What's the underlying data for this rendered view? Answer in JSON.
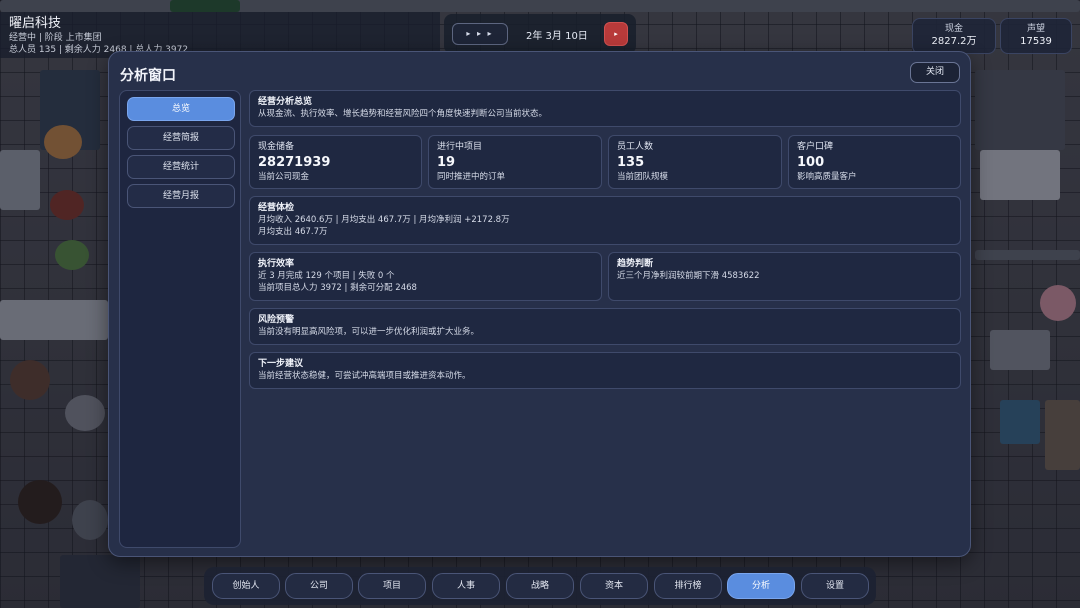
{
  "hud": {
    "company_name": "曜启科技",
    "status_line": "经营中 | 阶段 上市集团",
    "staff_line": "总人员 135 | 剩余人力 2468 | 总人力 3972",
    "speed_label": "▸ ▸ ▸",
    "date": "2年 3月 10日",
    "pause_label": "▸",
    "cash": {
      "label": "现金",
      "value": "2827.2万"
    },
    "reputation": {
      "label": "声望",
      "value": "17539"
    }
  },
  "window": {
    "title": "分析窗口",
    "close_label": "关闭",
    "nav": [
      {
        "label": "总览",
        "active": true
      },
      {
        "label": "经营简报",
        "active": false
      },
      {
        "label": "经营统计",
        "active": false
      },
      {
        "label": "经营月报",
        "active": false
      }
    ],
    "overview": {
      "title": "经营分析总览",
      "desc": "从现金流、执行效率、增长趋势和经营风险四个角度快速判断公司当前状态。"
    },
    "kpis": [
      {
        "label": "现金储备",
        "value": "28271939",
        "sub": "当前公司现金"
      },
      {
        "label": "进行中项目",
        "value": "19",
        "sub": "同时推进中的订单"
      },
      {
        "label": "员工人数",
        "value": "135",
        "sub": "当前团队规模"
      },
      {
        "label": "客户口碑",
        "value": "100",
        "sub": "影响高质量客户"
      }
    ],
    "health": {
      "title": "经营体检",
      "line1": "月均收入 2640.6万 | 月均支出 467.7万 | 月均净利润 +2172.8万",
      "line2": "月均支出 467.7万"
    },
    "efficiency": {
      "title": "执行效率",
      "line1": "近 3 月完成 129 个项目 | 失败 0 个",
      "line2": "当前项目总人力 3972 | 剩余可分配 2468"
    },
    "trend": {
      "title": "趋势判断",
      "line1": "近三个月净利润较前期下滑 4583622"
    },
    "risk": {
      "title": "风险预警",
      "line1": "当前没有明显高风险项，可以进一步优化利润或扩大业务。"
    },
    "next": {
      "title": "下一步建议",
      "line1": "当前经营状态稳健，可尝试冲高端项目或推进资本动作。"
    }
  },
  "bottom_tabs": [
    {
      "label": "创始人",
      "active": false
    },
    {
      "label": "公司",
      "active": false
    },
    {
      "label": "项目",
      "active": false
    },
    {
      "label": "人事",
      "active": false
    },
    {
      "label": "战略",
      "active": false
    },
    {
      "label": "资本",
      "active": false
    },
    {
      "label": "排行榜",
      "active": false
    },
    {
      "label": "分析",
      "active": true
    },
    {
      "label": "设置",
      "active": false
    }
  ],
  "colors": {
    "accent": "#5a8ddf",
    "panel": "#27304a",
    "card": "#1f2841",
    "danger": "#b83a3a"
  }
}
